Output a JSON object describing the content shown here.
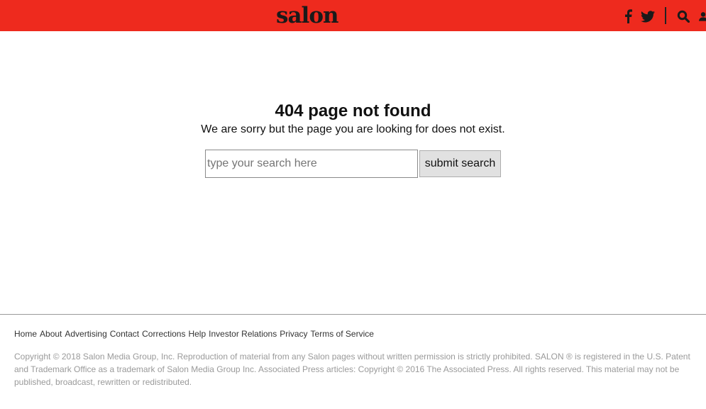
{
  "header": {
    "logo_text": "salon",
    "background_color": "#ee2a1e",
    "icons": [
      "facebook-icon",
      "twitter-icon",
      "search-icon",
      "user-icon"
    ]
  },
  "main": {
    "title": "404 page not found",
    "message": "We are sorry but the page you are looking for does not exist.",
    "search": {
      "placeholder": "type your search here",
      "value": "",
      "submit_label": "submit search"
    }
  },
  "footer": {
    "links": [
      "Home",
      "About",
      "Advertising",
      "Contact",
      "Corrections",
      "Help",
      "Investor Relations",
      "Privacy",
      "Terms of Service"
    ],
    "copyright": "Copyright © 2018 Salon Media Group, Inc. Reproduction of material from any Salon pages without written permission is strictly prohibited. SALON ® is registered in the U.S. Patent and Trademark Office as a trademark of Salon Media Group Inc. Associated Press articles: Copyright © 2016 The Associated Press. All rights reserved. This material may not be published, broadcast, rewritten or redistributed."
  }
}
